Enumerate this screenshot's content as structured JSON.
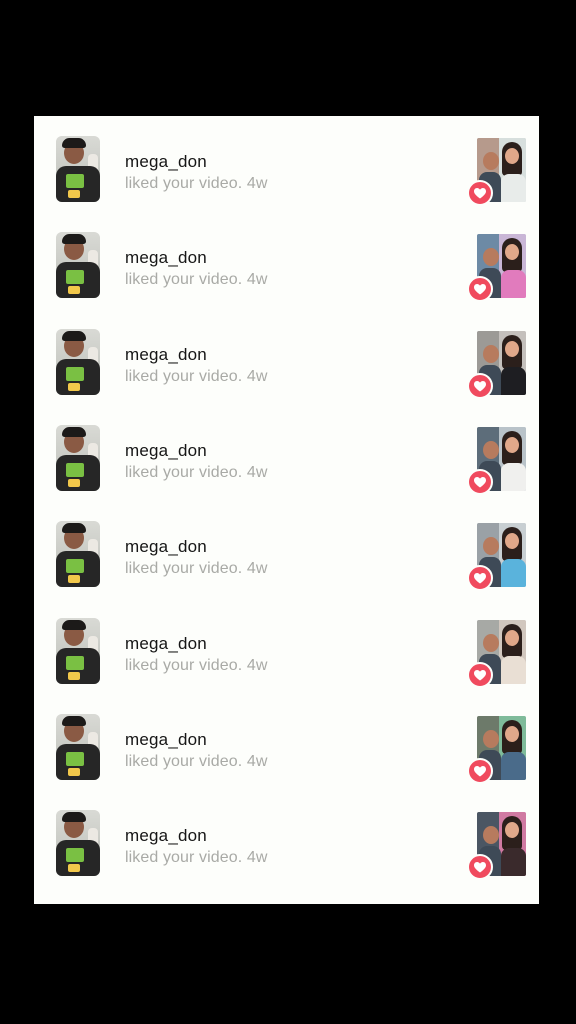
{
  "notifications": [
    {
      "username": "mega_don",
      "text": "liked your video. 4w",
      "thumb": {
        "left": "#b69a8c",
        "right": "#d7dfdd",
        "body2": "#e8ecea"
      }
    },
    {
      "username": "mega_don",
      "text": "liked your video. 4w",
      "thumb": {
        "left": "#6d8aa5",
        "right": "#c9b6d6",
        "body2": "#e17bbd"
      }
    },
    {
      "username": "mega_don",
      "text": "liked your video. 4w",
      "thumb": {
        "left": "#9c9a96",
        "right": "#c4c0bc",
        "body2": "#1e1e22"
      }
    },
    {
      "username": "mega_don",
      "text": "liked your video. 4w",
      "thumb": {
        "left": "#5d6d7a",
        "right": "#b9c3c9",
        "body2": "#f0f0ee"
      }
    },
    {
      "username": "mega_don",
      "text": "liked your video. 4w",
      "thumb": {
        "left": "#9aa1a6",
        "right": "#c8cfd2",
        "body2": "#5ab3dc"
      }
    },
    {
      "username": "mega_don",
      "text": "liked your video. 4w",
      "thumb": {
        "left": "#a7a9a5",
        "right": "#d1c7be",
        "body2": "#e9dfd4"
      }
    },
    {
      "username": "mega_don",
      "text": "liked your video. 4w",
      "thumb": {
        "left": "#6d7a6a",
        "right": "#7fbb9a",
        "body2": "#4a6b8a"
      }
    },
    {
      "username": "mega_don",
      "text": "liked your video. 4w",
      "thumb": {
        "left": "#4b5663",
        "right": "#d07aa2",
        "body2": "#3a2a2c"
      }
    }
  ],
  "icons": {
    "badge": "heart-icon"
  },
  "colors": {
    "heart": "#f04a5e",
    "username": "#161616",
    "subtext": "#a9aaa6",
    "background": "#fdfefb"
  }
}
